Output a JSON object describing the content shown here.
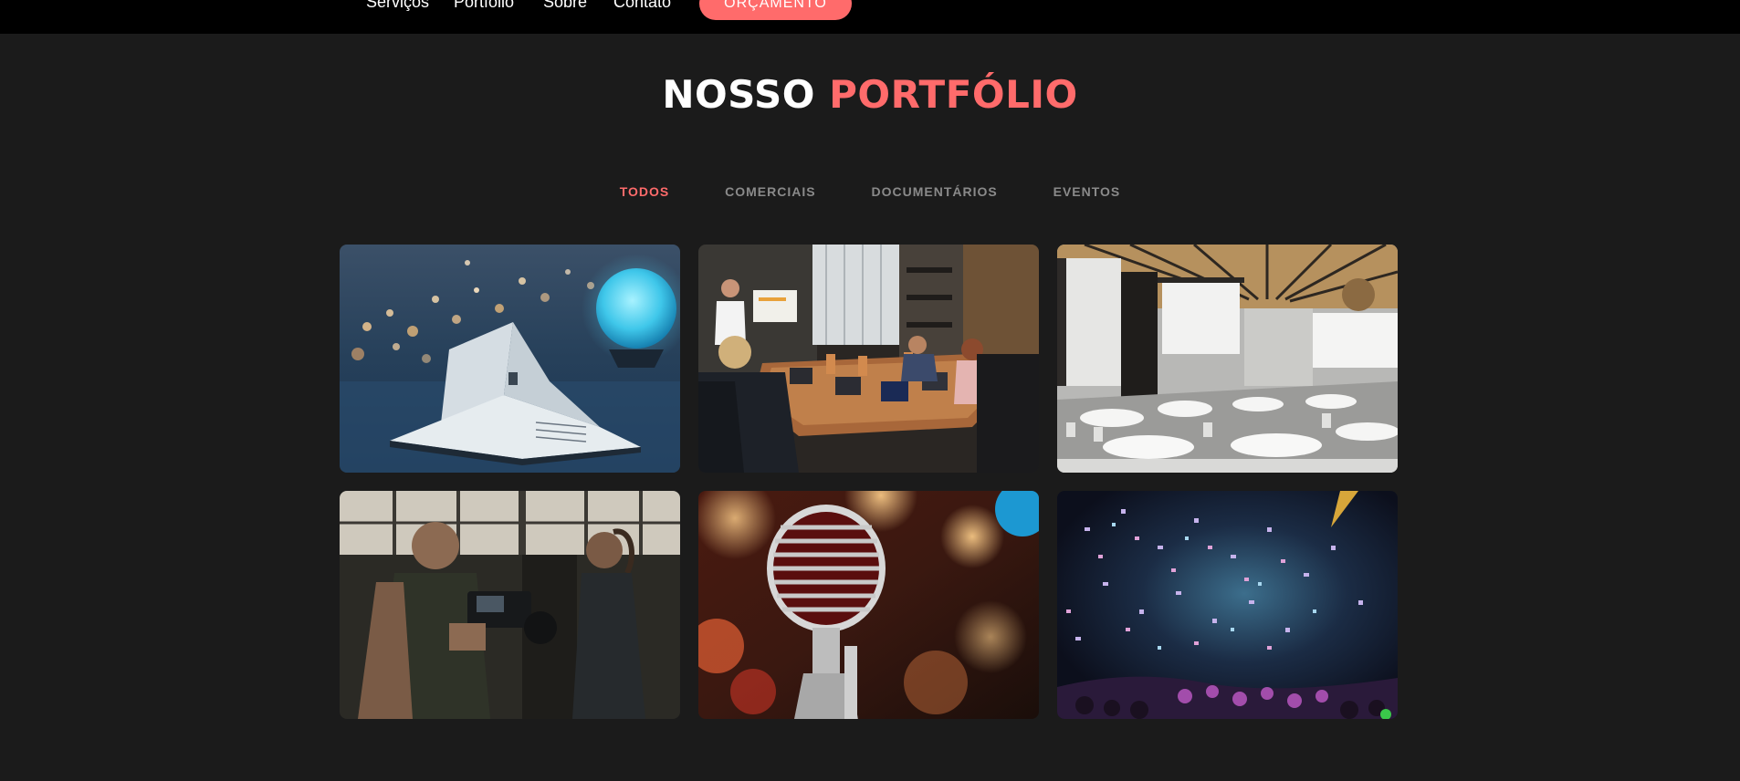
{
  "nav": {
    "links": [
      "Serviços",
      "Portfólio",
      "Sobre",
      "Contato"
    ],
    "cta": "ORÇAMENTO"
  },
  "section": {
    "title_white": "NOSSO",
    "title_accent": "PORTFÓLIO"
  },
  "filters": [
    "TODOS",
    "COMERCIAIS",
    "DOCUMENTÁRIOS",
    "EVENTOS"
  ],
  "colors": {
    "accent": "#ff6b6b",
    "background": "#1b1b1b",
    "topbar": "#000000"
  },
  "portfolio_items": [
    {
      "subject": "book-with-lights-image"
    },
    {
      "subject": "meeting-presentation-image"
    },
    {
      "subject": "conference-hall-image"
    },
    {
      "subject": "camera-operator-image"
    },
    {
      "subject": "vintage-microphone-image"
    },
    {
      "subject": "concert-confetti-image"
    }
  ]
}
